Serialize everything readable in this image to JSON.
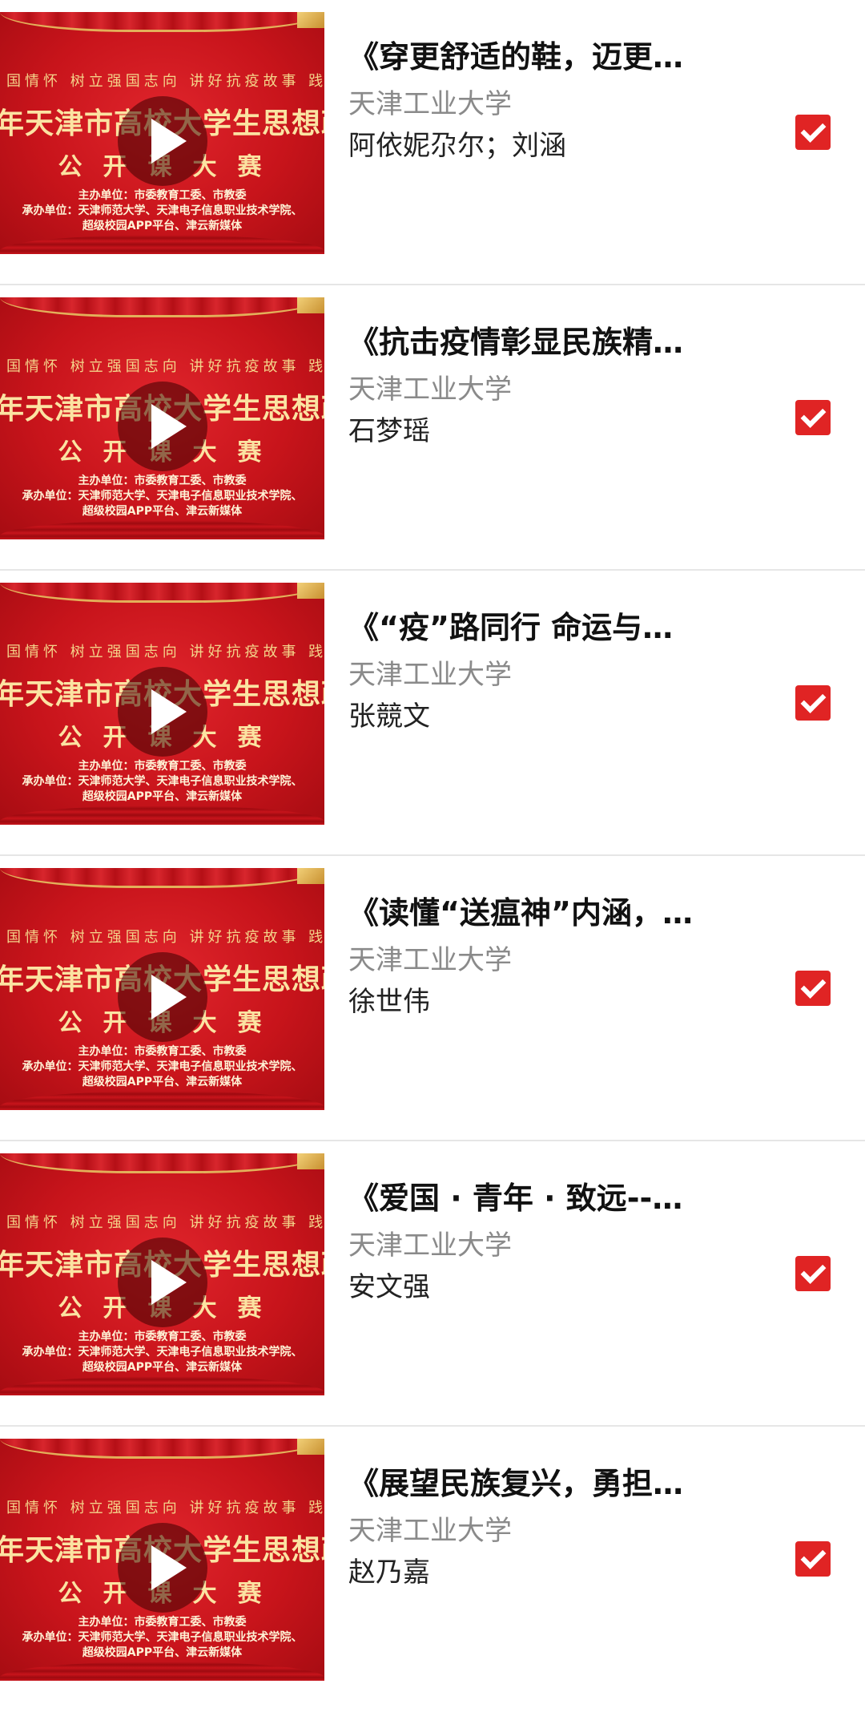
{
  "thumbnail": {
    "line1": "国情怀 树立强国志向 讲好抗疫故事 践行",
    "line2": "年天津市高校大学生思想政治理",
    "line3": "公开课大赛",
    "line4": "主办单位：市委教育工委、市教委\n承办单位：天津师范大学、天津电子信息职业技术学院、\n超级校园APP平台、津云新媒体",
    "play_icon": "play-icon"
  },
  "items": [
    {
      "title": "《穿更舒适的鞋，迈更…",
      "school": "天津工业大学",
      "author": "阿依妮尕尔；刘涵",
      "checked": true
    },
    {
      "title": "《抗击疫情彰显民族精…",
      "school": "天津工业大学",
      "author": "石梦瑶",
      "checked": true
    },
    {
      "title": "《“疫”路同行 命运与…",
      "school": "天津工业大学",
      "author": "张競文",
      "checked": true
    },
    {
      "title": "《读懂“送瘟神”内涵，…",
      "school": "天津工业大学",
      "author": "徐世伟",
      "checked": true
    },
    {
      "title": "《爱国 · 青年 · 致远--…",
      "school": "天津工业大学",
      "author": "安文强",
      "checked": true
    },
    {
      "title": "《展望民族复兴，勇担…",
      "school": "天津工业大学",
      "author": "赵乃嘉",
      "checked": true
    }
  ],
  "colors": {
    "accent": "#e02424",
    "thumbnail_red": "#c8141b",
    "gold_text": "#fbe3a2"
  }
}
